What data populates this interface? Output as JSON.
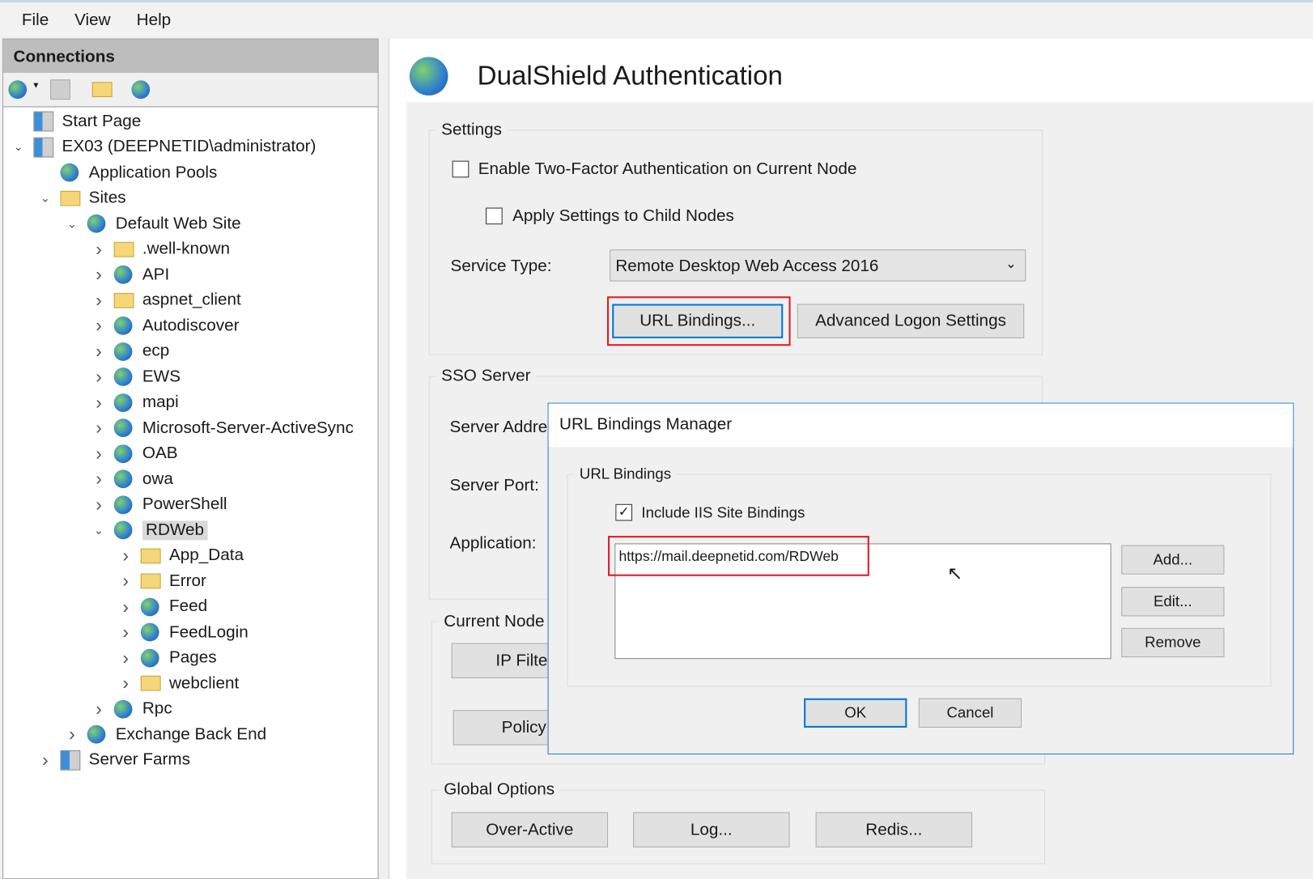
{
  "menu": [
    "File",
    "View",
    "Help"
  ],
  "connections": {
    "title": "Connections",
    "toolbar_icons": [
      "connect-globe-icon",
      "save-icon",
      "up-folder-icon",
      "disconnect-icon"
    ],
    "tree": [
      {
        "label": "Start Page",
        "level": 0,
        "icon": "server",
        "expand": ""
      },
      {
        "label": "EX03 (DEEPNETID\\administrator)",
        "level": 0,
        "icon": "server",
        "expand": "open"
      },
      {
        "label": "Application Pools",
        "level": 1,
        "icon": "globe",
        "expand": ""
      },
      {
        "label": "Sites",
        "level": 1,
        "icon": "folder",
        "expand": "open"
      },
      {
        "label": "Default Web Site",
        "level": 2,
        "icon": "globe",
        "expand": "open"
      },
      {
        "label": ".well-known",
        "level": 3,
        "icon": "folder",
        "expand": "closed"
      },
      {
        "label": "API",
        "level": 3,
        "icon": "globe",
        "expand": "closed"
      },
      {
        "label": "aspnet_client",
        "level": 3,
        "icon": "folder",
        "expand": "closed"
      },
      {
        "label": "Autodiscover",
        "level": 3,
        "icon": "globe",
        "expand": "closed"
      },
      {
        "label": "ecp",
        "level": 3,
        "icon": "globe",
        "expand": "closed"
      },
      {
        "label": "EWS",
        "level": 3,
        "icon": "globe",
        "expand": "closed"
      },
      {
        "label": "mapi",
        "level": 3,
        "icon": "globe",
        "expand": "closed"
      },
      {
        "label": "Microsoft-Server-ActiveSync",
        "level": 3,
        "icon": "globe",
        "expand": "closed"
      },
      {
        "label": "OAB",
        "level": 3,
        "icon": "globe",
        "expand": "closed"
      },
      {
        "label": "owa",
        "level": 3,
        "icon": "globe",
        "expand": "closed"
      },
      {
        "label": "PowerShell",
        "level": 3,
        "icon": "globe",
        "expand": "closed"
      },
      {
        "label": "RDWeb",
        "level": 3,
        "icon": "globe",
        "expand": "open",
        "selected": true
      },
      {
        "label": "App_Data",
        "level": 4,
        "icon": "folder",
        "expand": "closed"
      },
      {
        "label": "Error",
        "level": 4,
        "icon": "folder",
        "expand": "closed"
      },
      {
        "label": "Feed",
        "level": 4,
        "icon": "globe",
        "expand": "closed"
      },
      {
        "label": "FeedLogin",
        "level": 4,
        "icon": "globe",
        "expand": "closed"
      },
      {
        "label": "Pages",
        "level": 4,
        "icon": "globe",
        "expand": "closed"
      },
      {
        "label": "webclient",
        "level": 4,
        "icon": "folder",
        "expand": "closed"
      },
      {
        "label": "Rpc",
        "level": 3,
        "icon": "globe",
        "expand": "closed"
      },
      {
        "label": "Exchange Back End",
        "level": 2,
        "icon": "globe",
        "expand": "closed"
      },
      {
        "label": "Server Farms",
        "level": 1,
        "icon": "server",
        "expand": "closed"
      }
    ]
  },
  "main": {
    "title": "DualShield Authentication",
    "settings": {
      "legend": "Settings",
      "enable_2fa": "Enable Two-Factor Authentication on Current Node",
      "apply_child": "Apply Settings to Child Nodes",
      "service_type_label": "Service Type:",
      "service_type_value": "Remote Desktop Web Access 2016",
      "url_bindings": "URL Bindings...",
      "advanced_logon": "Advanced Logon Settings"
    },
    "sso": {
      "legend": "SSO Server",
      "server_address": "Server Addre",
      "server_port": "Server Port:",
      "application": "Application:"
    },
    "current_node": {
      "legend": "Current Node",
      "ip_filter": "IP Filte",
      "policy": "Policy"
    },
    "global": {
      "legend": "Global Options",
      "over_active": "Over-Active",
      "log": "Log...",
      "redis": "Redis..."
    }
  },
  "dialog": {
    "title": "URL Bindings Manager",
    "group": "URL Bindings",
    "include_iis": "Include IIS Site Bindings",
    "include_iis_checked": true,
    "bindings": [
      "https://mail.deepnetid.com/RDWeb"
    ],
    "add": "Add...",
    "edit": "Edit...",
    "remove": "Remove",
    "ok": "OK",
    "cancel": "Cancel"
  }
}
